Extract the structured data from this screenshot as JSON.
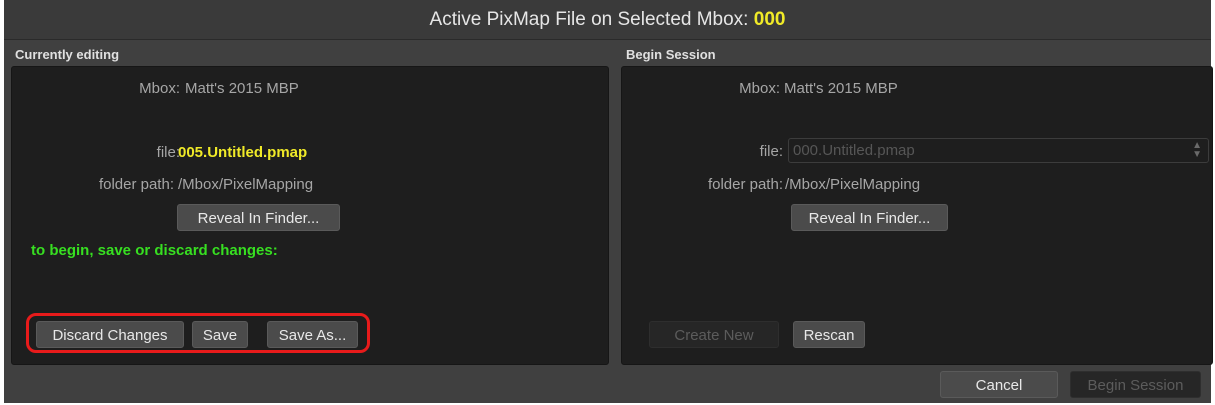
{
  "title": {
    "prefix": "Active PixMap File on Selected Mbox:",
    "mbox_id": "000"
  },
  "currently_editing": {
    "label": "Currently editing",
    "mbox_label": "Mbox:",
    "mbox_value": "Matt's 2015 MBP",
    "file_label": "file:",
    "file_value": "005.Untitled.pmap",
    "folder_label": "folder path:",
    "folder_value": "/Mbox/PixelMapping",
    "reveal_button": "Reveal In Finder...",
    "hint": "to begin, save or discard changes:",
    "discard_button": "Discard Changes",
    "save_button": "Save",
    "save_as_button": "Save As..."
  },
  "begin_session": {
    "label": "Begin Session",
    "mbox_label": "Mbox:",
    "mbox_value": "Matt's 2015 MBP",
    "file_label": "file:",
    "file_select_value": "000.Untitled.pmap",
    "folder_label": "folder path:",
    "folder_value": "/Mbox/PixelMapping",
    "reveal_button": "Reveal In Finder...",
    "create_new_button": "Create New",
    "rescan_button": "Rescan"
  },
  "footer": {
    "cancel_button": "Cancel",
    "begin_session_button": "Begin Session"
  },
  "colors": {
    "accent_yellow": "#f0ea28",
    "hint_green": "#37df21",
    "highlight_red": "#e81b1b"
  }
}
